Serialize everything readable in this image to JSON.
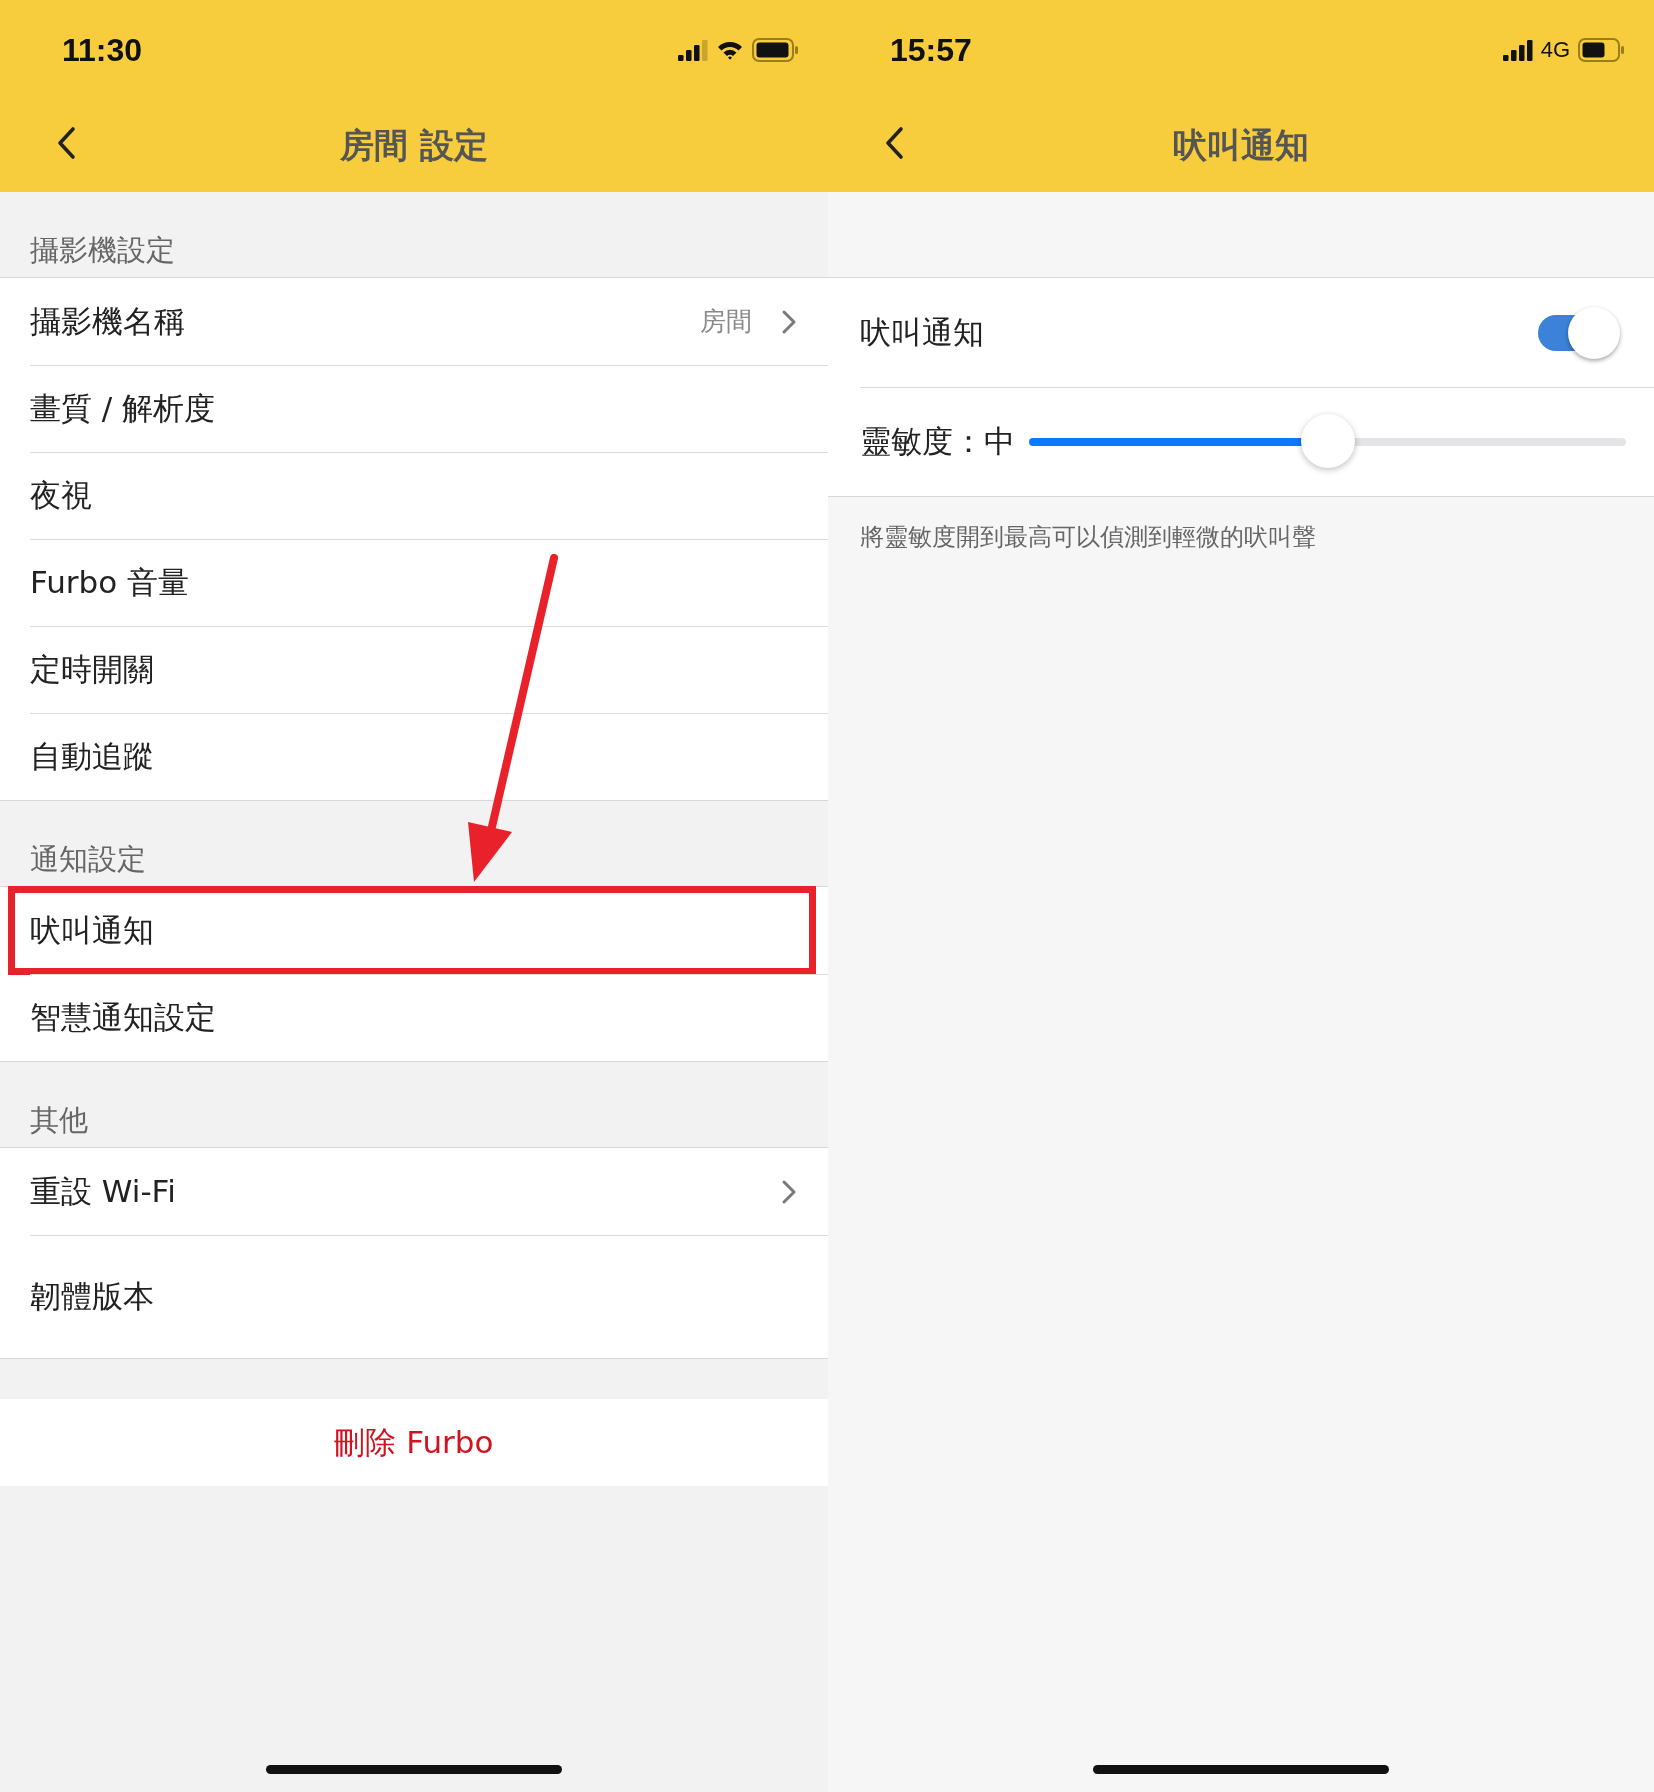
{
  "screens": [
    {
      "status_bar": {
        "time": "11:30",
        "kind": "wifi",
        "signal_dim_last": true
      },
      "nav": {
        "title": "房間 設定"
      },
      "sections": [
        {
          "header": "攝影機設定",
          "rows": [
            {
              "label": "攝影機名稱",
              "value": "房間",
              "chevron": true,
              "highlighted": false
            },
            {
              "label": "畫質 / 解析度",
              "chevron": false,
              "highlighted": false
            },
            {
              "label": "夜視",
              "chevron": false,
              "highlighted": false
            },
            {
              "label": "Furbo 音量",
              "chevron": false,
              "highlighted": false
            },
            {
              "label": "定時開關",
              "chevron": false,
              "highlighted": false
            },
            {
              "label": "自動追蹤",
              "chevron": false,
              "highlighted": false
            }
          ]
        },
        {
          "header": "通知設定",
          "rows": [
            {
              "label": "吠叫通知",
              "chevron": false,
              "highlighted": true
            },
            {
              "label": "智慧通知設定",
              "chevron": false,
              "highlighted": false
            }
          ]
        },
        {
          "header": "其他",
          "rows": [
            {
              "label": "重設 Wi-Fi",
              "chevron": true,
              "highlighted": false
            },
            {
              "label": "韌體版本",
              "chevron": false,
              "highlighted": false
            }
          ]
        }
      ],
      "delete_button": "刪除 Furbo"
    },
    {
      "status_bar": {
        "time": "15:57",
        "kind": "cellular",
        "network_label": "4G",
        "signal_dim_last": false
      },
      "nav": {
        "title": "吠叫通知"
      },
      "toggle_row": {
        "label": "吠叫通知",
        "on": true
      },
      "slider_row": {
        "label": "靈敏度：中",
        "level": 0.5
      },
      "note": "將靈敏度開到最高可以偵測到輕微的吠叫聲"
    }
  ]
}
